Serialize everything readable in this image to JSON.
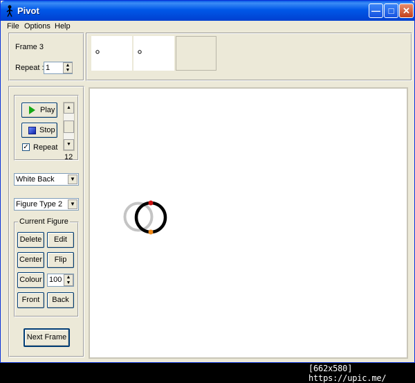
{
  "window": {
    "title": "Pivot"
  },
  "menu": {
    "file": "File",
    "options": "Options",
    "help": "Help"
  },
  "frame_panel": {
    "frame_label": "Frame 3",
    "repeat_label": "Repeat :",
    "repeat_value": "1"
  },
  "playback": {
    "play_label": "Play",
    "stop_label": "Stop",
    "repeat_checkbox_label": "Repeat",
    "repeat_checked": true,
    "speed_value": "12"
  },
  "background_select": {
    "selected": "White Back"
  },
  "figure_type_select": {
    "selected": "Figure Type 2"
  },
  "current_figure": {
    "group_label": "Current Figure",
    "delete_label": "Delete",
    "edit_label": "Edit",
    "center_label": "Center",
    "flip_label": "Flip",
    "colour_label": "Colour",
    "colour_value": "100",
    "front_label": "Front",
    "back_label": "Back"
  },
  "next_frame_label": "Next Frame",
  "footer_text": "[662x580] https://upic.me/",
  "colors": {
    "handle_top": "#cc1111",
    "handle_bottom": "#f08a1a",
    "ghost": "#c4c4c4"
  }
}
